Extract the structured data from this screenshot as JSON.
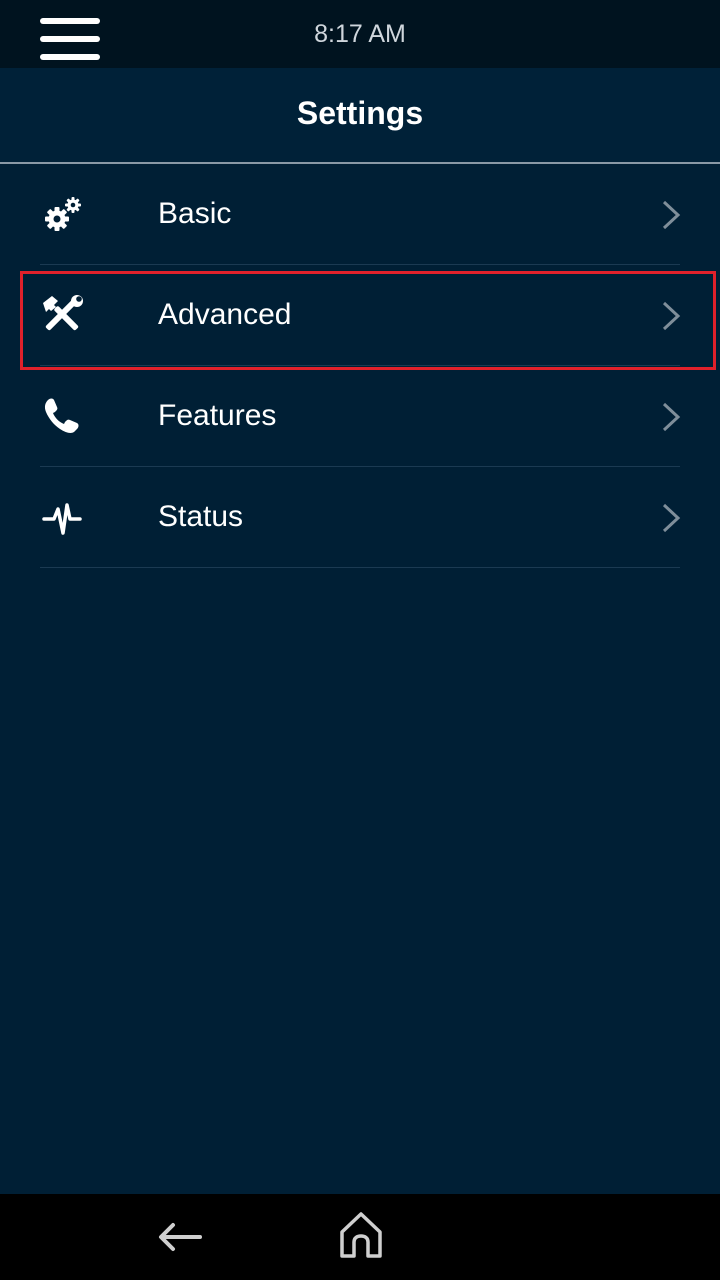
{
  "status_bar": {
    "time": "8:17 AM"
  },
  "header": {
    "title": "Settings"
  },
  "settings_list": [
    {
      "label": "Basic",
      "icon": "gears-icon"
    },
    {
      "label": "Advanced",
      "icon": "tools-icon",
      "highlighted": true
    },
    {
      "label": "Features",
      "icon": "phone-icon"
    },
    {
      "label": "Status",
      "icon": "pulse-icon"
    }
  ],
  "nav_bar": {
    "back_icon": "back-arrow-icon",
    "home_icon": "home-icon"
  },
  "colors": {
    "background": "#001f35",
    "status_bar": "#00131f",
    "highlight": "#e0212b",
    "text": "#ffffff",
    "chevron": "#7f8e9a"
  }
}
